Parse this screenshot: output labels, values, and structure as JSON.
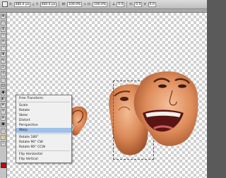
{
  "options_bar": {
    "x_value": "480.0 px",
    "y_value": "400.0 px",
    "w_value": "100.0%",
    "h_value": "100.0%",
    "angle_value": "0.0",
    "h_skew_value": "0.0",
    "v_skew_value": "0.0"
  },
  "context_menu": {
    "items": [
      "Free Transform",
      "Scale",
      "Rotate",
      "Skew",
      "Distort",
      "Perspective",
      "Warp",
      "Rotate 180°",
      "Rotate 90° CW",
      "Rotate 90° CCW",
      "Flip Horizontal",
      "Flip Vertical"
    ],
    "selected": "Warp"
  },
  "colors": {
    "foreground": "#cc0000",
    "background": "#ffffff",
    "menu_highlight": "#9fc0e8"
  },
  "icons": [
    "move-tool-icon",
    "marquee-tool-icon",
    "lasso-tool-icon",
    "crop-tool-icon",
    "brush-tool-icon",
    "eraser-tool-icon",
    "type-tool-icon",
    "hand-tool-icon",
    "zoom-tool-icon"
  ]
}
